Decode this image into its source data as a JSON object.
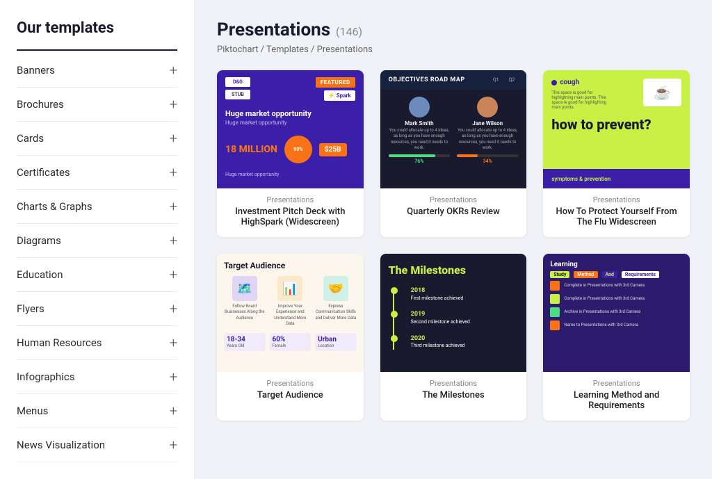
{
  "sidebar": {
    "title": "Our templates",
    "items": [
      {
        "id": "banners",
        "label": "Banners"
      },
      {
        "id": "brochures",
        "label": "Brochures"
      },
      {
        "id": "cards",
        "label": "Cards"
      },
      {
        "id": "certificates",
        "label": "Certificates"
      },
      {
        "id": "charts-graphs",
        "label": "Charts & Graphs"
      },
      {
        "id": "diagrams",
        "label": "Diagrams"
      },
      {
        "id": "education",
        "label": "Education"
      },
      {
        "id": "flyers",
        "label": "Flyers"
      },
      {
        "id": "human-resources",
        "label": "Human Resources"
      },
      {
        "id": "infographics",
        "label": "Infographics"
      },
      {
        "id": "menus",
        "label": "Menus"
      },
      {
        "id": "news-visualization",
        "label": "News Visualization"
      }
    ],
    "plus_icon": "+"
  },
  "page": {
    "title": "Presentations",
    "count": "(146)",
    "breadcrumb": "Piktochart / Templates / Presentations"
  },
  "templates": [
    {
      "id": "investment-pitch",
      "category": "Presentations",
      "name": "Investment Pitch Deck with HighSpark (Widescreen)",
      "logo1": "D&G",
      "logo2": "STUB",
      "featured": "FEATURED",
      "spark_label": "Spark",
      "headline": "Huge market opportunity",
      "sub": "Huge market opportunity",
      "amount": "18 MILLION",
      "circle_text": "90%",
      "badge": "$25B"
    },
    {
      "id": "quarterly-okrs",
      "category": "Presentations",
      "name": "Quarterly OKRs Review",
      "title": "OBJECTIVES ROAD MAP",
      "tab1": "Q1",
      "tab2": "Q2",
      "person1_name": "Mark Smith",
      "person2_name": "Jane Wilson",
      "pct1": "76%",
      "pct2": "34%"
    },
    {
      "id": "flu-widescreen",
      "category": "Presentations",
      "name": "How To Protect Yourself From The Flu Widescreen",
      "cough": "• cough",
      "main_text": "how to prevent?",
      "bottom_text": "symptoms & prevention"
    },
    {
      "id": "target-audience",
      "category": "Presentations",
      "name": "Target Audience",
      "title": "Target Audience",
      "col1_label": "Follow Board Businesses Along the Audience",
      "col2_label": "Improve Your Experience and Understand More Data",
      "col3_label": "Express Communication Skills and Deliver More Data"
    },
    {
      "id": "milestones",
      "category": "Presentations",
      "name": "The Milestones",
      "title": "The Milestones",
      "items": [
        {
          "year": "2018",
          "text": "First milestone achieved"
        },
        {
          "year": "2019",
          "text": "Second milestone achieved"
        },
        {
          "year": "2020",
          "text": "Third milestone achieved"
        }
      ]
    },
    {
      "id": "learning-method",
      "category": "Presentations",
      "name": "Learning Method and Requirements",
      "title": "Learning Method and Requirements",
      "sub": "Complete in Presentations with 3rd Camera",
      "items": [
        {
          "label": "Complete in Presentations with 3rd Camera",
          "tag": ""
        },
        {
          "label": "Complete in Presentations with 3rd Camera",
          "tag": ""
        },
        {
          "label": "Archive in Presentations with 3rd Camera",
          "tag": ""
        },
        {
          "label": "Name to Presentations with 3rd Camera",
          "tag": ""
        }
      ]
    }
  ]
}
